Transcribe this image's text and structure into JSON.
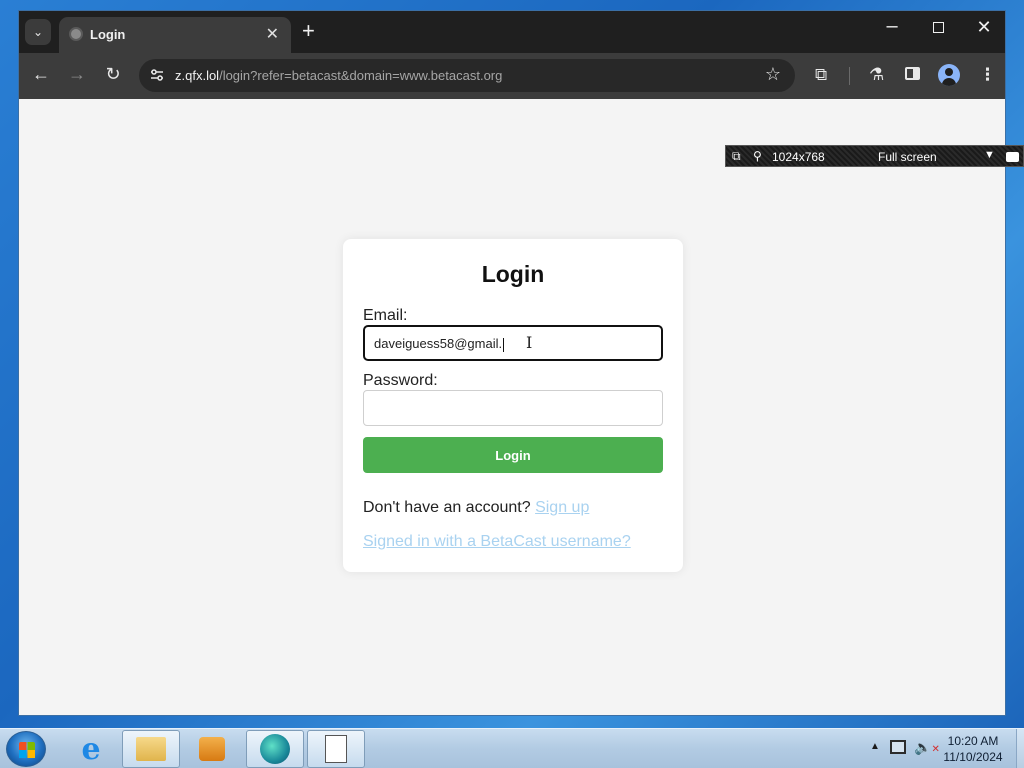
{
  "browser": {
    "tab_title": "Login",
    "tab_close": "✕",
    "new_tab": "+",
    "url_domain": "z.qfx.lol",
    "url_path": "/login?refer=betacast&domain=www.betacast.org"
  },
  "page": {
    "title": "Login",
    "email_label": "Email:",
    "email_value": "daveiguess58@gmail.",
    "password_label": "Password:",
    "password_value": "",
    "login_button": "Login",
    "signup_prompt": "Don't have an account?",
    "signup_link": "Sign up",
    "betacast_link": "Signed in with a BetaCast username?"
  },
  "screen_tool": {
    "resolution": "1024x768",
    "mode": "Full screen"
  },
  "taskbar": {
    "time": "10:20 AM",
    "date": "11/10/2024"
  },
  "colors": {
    "login_button": "#4caf50",
    "link": "#a9d2f0",
    "browser_chrome": "#1f1f1f"
  }
}
